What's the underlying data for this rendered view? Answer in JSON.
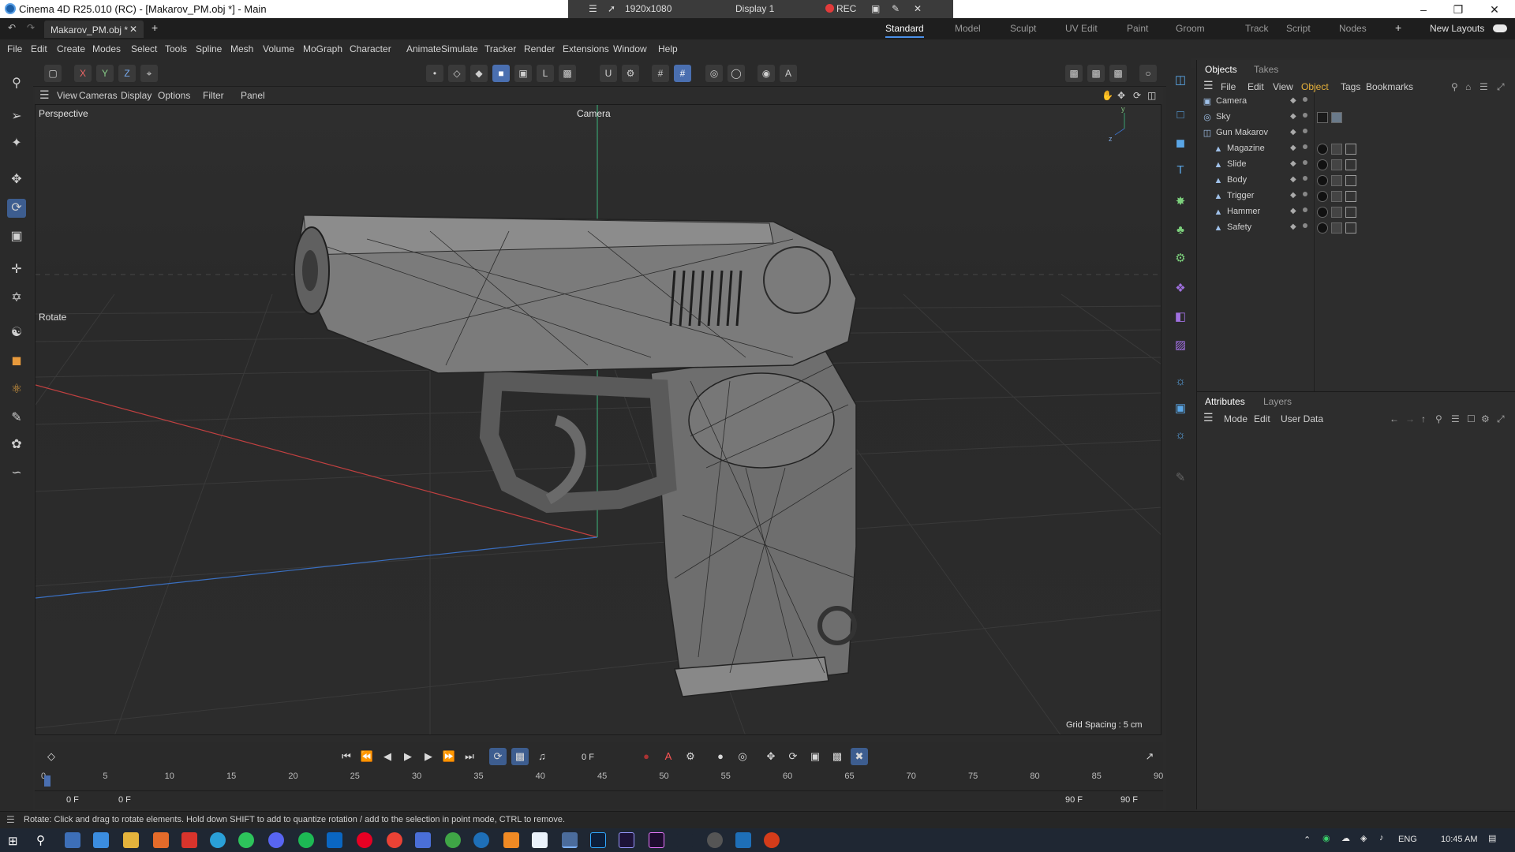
{
  "titlebar": {
    "title": "Cinema 4D R25.010 (RC) - [Makarov_PM.obj *] - Main",
    "minimize_icon": "minimize-icon",
    "restore_icon": "restore-icon",
    "close_icon": "close-icon"
  },
  "recorder": {
    "resolution": "1920x1080",
    "display": "Display 1",
    "rec_label": "REC"
  },
  "tabs": {
    "document": "Makarov_PM.obj *",
    "layouts": [
      "Standard",
      "Model",
      "Sculpt",
      "UV Edit",
      "Paint",
      "Groom",
      "Track",
      "Script",
      "Nodes"
    ],
    "active_layout": "Standard",
    "new_layouts": "New Layouts"
  },
  "menu": [
    "File",
    "Edit",
    "Create",
    "Modes",
    "Select",
    "Tools",
    "Spline",
    "Mesh",
    "Volume",
    "MoGraph",
    "Character",
    "Animate",
    "Simulate",
    "Tracker",
    "Render",
    "Extensions",
    "Window",
    "Help"
  ],
  "axis_lock": [
    "X",
    "Y",
    "Z"
  ],
  "viewport_menu": [
    "View",
    "Cameras",
    "Display",
    "Options",
    "Filter",
    "Panel"
  ],
  "viewport": {
    "projection": "Perspective",
    "camera": "Camera",
    "tool_label": "Rotate",
    "grid_spacing": "Grid Spacing : 5 cm"
  },
  "objects_panel": {
    "tabs": [
      "Objects",
      "Takes"
    ],
    "menu": [
      "File",
      "Edit",
      "View",
      "Object",
      "Tags",
      "Bookmarks"
    ],
    "active_menu": "Object",
    "items": [
      {
        "name": "Camera",
        "icon": "camera-icon"
      },
      {
        "name": "Sky",
        "icon": "sky-icon"
      },
      {
        "name": "Gun Makarov",
        "icon": "null-icon"
      },
      {
        "name": "Magazine",
        "icon": "polygon-icon"
      },
      {
        "name": "Slide",
        "icon": "polygon-icon"
      },
      {
        "name": "Body",
        "icon": "polygon-icon"
      },
      {
        "name": "Trigger",
        "icon": "polygon-icon"
      },
      {
        "name": "Hammer",
        "icon": "polygon-icon"
      },
      {
        "name": "Safety",
        "icon": "polygon-icon"
      }
    ]
  },
  "attributes_panel": {
    "tabs": [
      "Attributes",
      "Layers"
    ],
    "menu": [
      "Mode",
      "Edit",
      "User Data"
    ]
  },
  "timeline": {
    "current_frame": "0 F",
    "ruler": [
      "0",
      "5",
      "10",
      "15",
      "20",
      "25",
      "30",
      "35",
      "40",
      "45",
      "50",
      "55",
      "60",
      "65",
      "70",
      "75",
      "80",
      "85",
      "90"
    ],
    "start_field": "0 F",
    "range_start": "0 F",
    "range_end": "90 F",
    "end_field": "90 F"
  },
  "status": {
    "message": "Rotate: Click and drag to rotate elements. Hold down SHIFT to add to quantize rotation / add to the selection in point mode, CTRL to remove."
  },
  "taskbar": {
    "language": "ENG",
    "time": "10:45 AM"
  },
  "colors": {
    "accent": "#4a8fe7",
    "active_tool": "#3d5d8f",
    "rec": "#e23b3b"
  }
}
